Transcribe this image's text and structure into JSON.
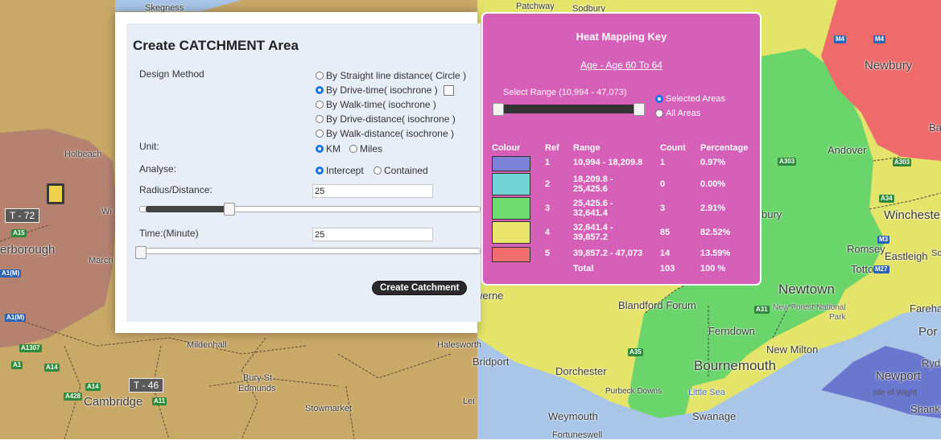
{
  "map_labels": {
    "skegness": "Skegness",
    "holbeach": "Holbeach",
    "peterborough": "erborough",
    "march": "March",
    "wi": "Wi",
    "mildenhall": "Mildenhall",
    "bury": "Bury St",
    "edmunds": "Edmunds",
    "cambridge": "Cambridge",
    "stowmarket": "Stowmarket",
    "leis": "Lei",
    "halesworth": "Halesworth",
    "t72": "T - 72",
    "t46": "T - 46",
    "patchway": "Patchway",
    "sodbury": "Sodbury",
    "newbury": "Newbury",
    "ba": "Ba",
    "andover": "Andover",
    "winchester": "Winchester",
    "bury2": "bury",
    "romsey": "Romsey",
    "eastleigh": "Eastleigh",
    "totton": "Totton",
    "newtown": "Newtown",
    "fareham": "Fareha",
    "newforest": "New Forest National",
    "park": "Park",
    "por": "Por",
    "blandford": "Blandford Forum",
    "ferndown": "Ferndown",
    "newmilton": "New Milton",
    "bournemouth": "Bournemouth",
    "rye": "Ryd",
    "newport": "Newport",
    "isleofwight": "Isle of Wight",
    "shank": "Shankl",
    "bridport": "Bridport",
    "dorchester": "Dorchester",
    "purbeck": "Purbeck Downs",
    "littlesea": "Little Sea",
    "weymouth": "Weymouth",
    "swanage": "Swanage",
    "fortuneswell": "Fortuneswell",
    "verne": "werne",
    "sc": "Sc"
  },
  "roads": {
    "a15": "A15",
    "a1m": "A1(M)",
    "a1m2": "A1(M)",
    "a1307": "A1307",
    "a1": "A1",
    "a14": "A14",
    "a142": "A14",
    "a428": "A428",
    "a11": "A11",
    "m4": "M4",
    "m42": "M4",
    "a303": "A303",
    "a3032": "A303",
    "a34": "A34",
    "m3": "M3",
    "m27": "M27",
    "a31": "A31",
    "a35": "A35"
  },
  "catchment": {
    "title": "Create CATCHMENT Area",
    "design_method_label": "Design Method",
    "methods": [
      "By Straight line distance( Circle )",
      "By Drive-time( isochrone )",
      "By Walk-time( isochrone )",
      "By Drive-distance( isochrone )",
      "By Walk-distance( isochrone )"
    ],
    "selected_method": 1,
    "unit_label": "Unit:",
    "unit_km": "KM",
    "unit_miles": "Miles",
    "analyse_label": "Analyse:",
    "analyse_intercept": "Intercept",
    "analyse_contained": "Contained",
    "radius_label": "Radius/Distance:",
    "radius_value": "25",
    "time_label": "Time:(Minute)",
    "time_value": "25",
    "create_button": "Create Catchment"
  },
  "heat_key": {
    "title": "Heat Mapping Key",
    "subtitle": "Age - Age 60 To 64",
    "range_label": "Select Range (10,994 - 47,073)",
    "opt_selected": "Selected Areas",
    "opt_all": "All Areas",
    "headers": {
      "colour": "Colour",
      "ref": "Ref",
      "range": "Range",
      "count": "Count",
      "percentage": "Percentage"
    },
    "rows": [
      {
        "ref": "1",
        "range": "10,994 - 18,209.8",
        "count": "1",
        "pct": "0.97%",
        "color": "#7b82d8"
      },
      {
        "ref": "2",
        "range": "18,209.8 - 25,425.6",
        "count": "0",
        "pct": "0.00%",
        "color": "#72d3d6"
      },
      {
        "ref": "3",
        "range": "25,425.6 - 32,641.4",
        "count": "3",
        "pct": "2.91%",
        "color": "#6ddb6d"
      },
      {
        "ref": "4",
        "range": "32,641.4 - 39,857.2",
        "count": "85",
        "pct": "82.52%",
        "color": "#ece56c"
      },
      {
        "ref": "5",
        "range": "39,857.2 - 47,073",
        "count": "14",
        "pct": "13.59%",
        "color": "#f26e6e"
      }
    ],
    "total_label": "Total",
    "total_count": "103",
    "total_pct": "100 %"
  },
  "colors": {
    "map_left": "#c9a968",
    "map_left_red": "#b5826f",
    "sea": "#a9c5e8",
    "yellow": "#e4e46b",
    "green": "#6ad56a",
    "red": "#ef6b6b",
    "blue": "#6a77cf",
    "key_bg": "#d65fb8"
  }
}
